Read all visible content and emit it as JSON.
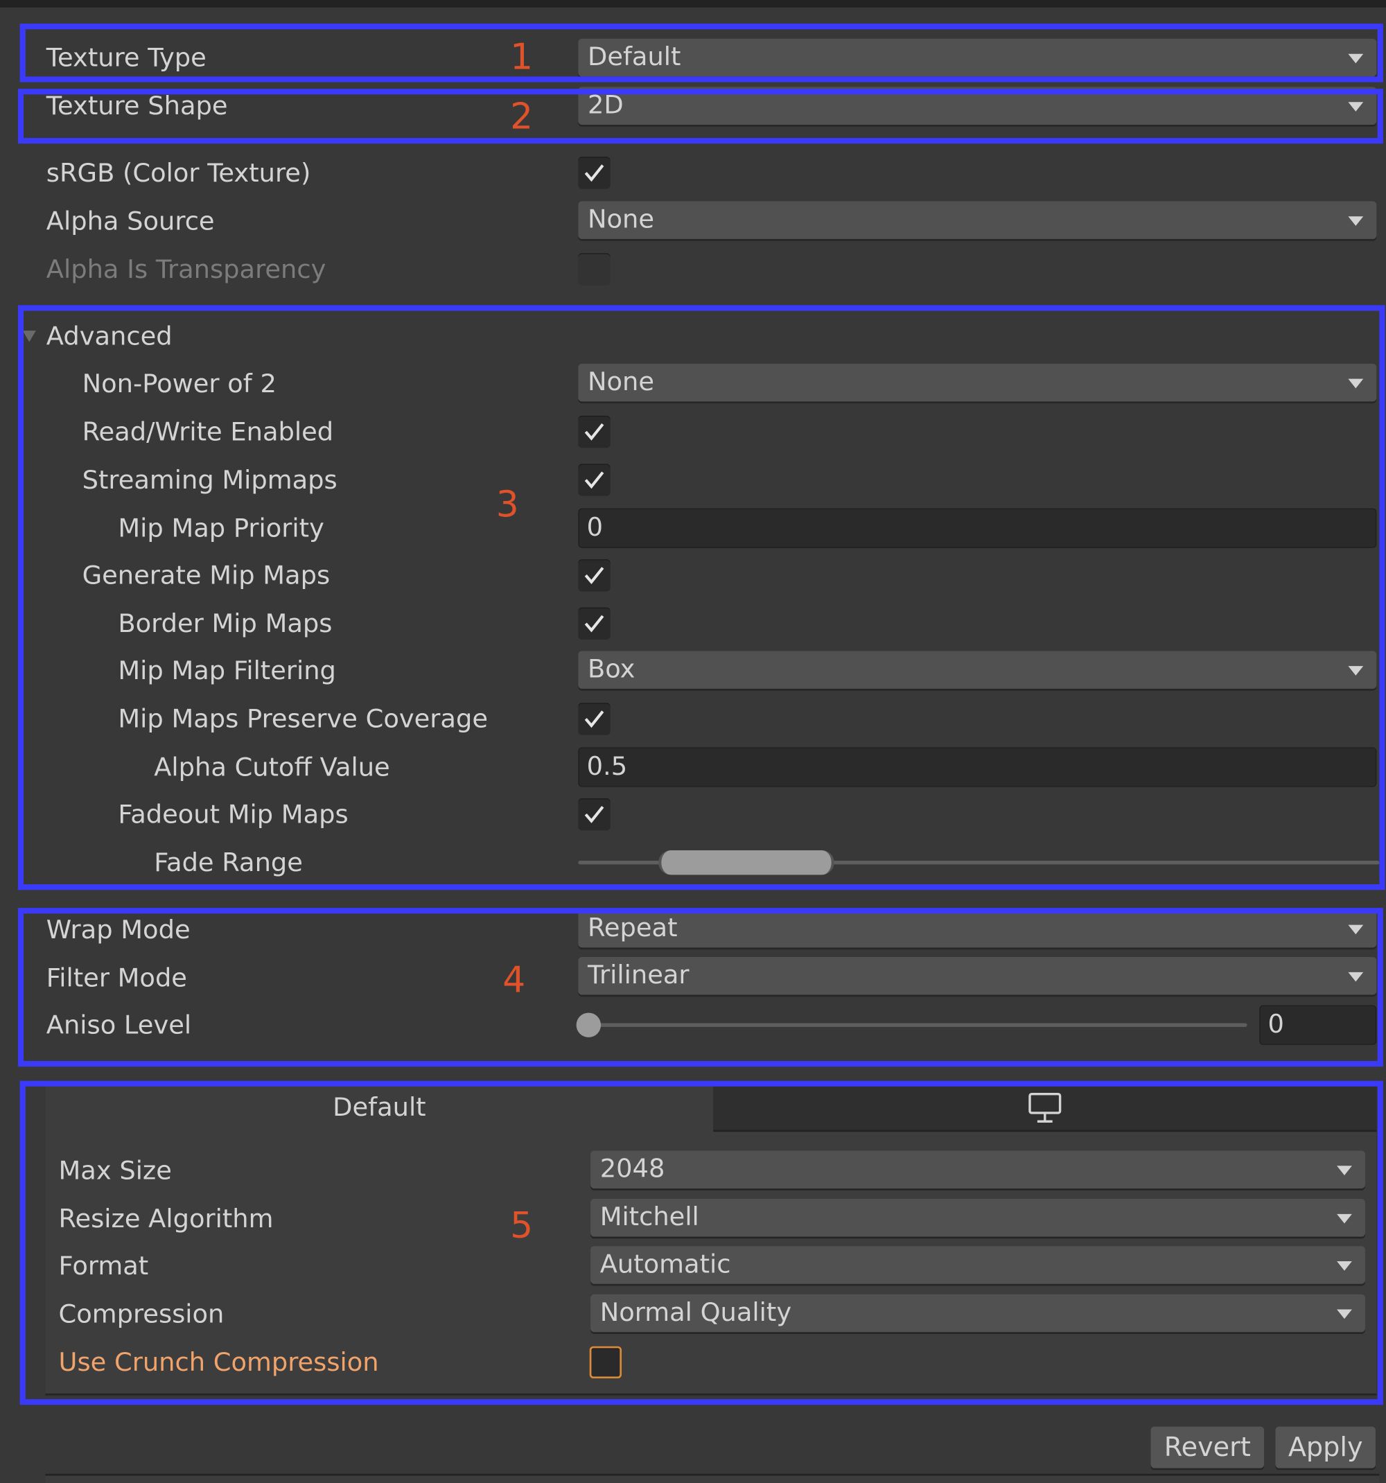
{
  "annotations": [
    "1",
    "2",
    "3",
    "4",
    "5"
  ],
  "colors": {
    "annotation_box": "#3a3af8",
    "annotation_number": "#e0522a",
    "warning_label": "#f0a36a",
    "background": "#383838"
  },
  "fields": {
    "texture_type": {
      "label": "Texture Type",
      "value": "Default"
    },
    "texture_shape": {
      "label": "Texture Shape",
      "value": "2D"
    },
    "srgb": {
      "label": "sRGB (Color Texture)",
      "checked": true
    },
    "alpha_source": {
      "label": "Alpha Source",
      "value": "None"
    },
    "alpha_is_transparency": {
      "label": "Alpha Is Transparency",
      "checked": false,
      "disabled": true
    }
  },
  "advanced": {
    "label": "Advanced",
    "expanded": true,
    "non_power_of_2": {
      "label": "Non-Power of 2",
      "value": "None"
    },
    "read_write": {
      "label": "Read/Write Enabled",
      "checked": true
    },
    "streaming_mipmaps": {
      "label": "Streaming Mipmaps",
      "checked": true
    },
    "mip_map_priority": {
      "label": "Mip Map Priority",
      "value": "0"
    },
    "generate_mip_maps": {
      "label": "Generate Mip Maps",
      "checked": true
    },
    "border_mip_maps": {
      "label": "Border Mip Maps",
      "checked": true
    },
    "mip_map_filtering": {
      "label": "Mip Map Filtering",
      "value": "Box"
    },
    "preserve_coverage": {
      "label": "Mip Maps Preserve Coverage",
      "checked": true
    },
    "alpha_cutoff": {
      "label": "Alpha Cutoff Value",
      "value": "0.5"
    },
    "fadeout_mip_maps": {
      "label": "Fadeout Mip Maps",
      "checked": true
    },
    "fade_range": {
      "label": "Fade Range",
      "min_fraction": 0.1,
      "max_fraction": 0.32
    }
  },
  "sampling": {
    "wrap_mode": {
      "label": "Wrap Mode",
      "value": "Repeat"
    },
    "filter_mode": {
      "label": "Filter Mode",
      "value": "Trilinear"
    },
    "aniso_level": {
      "label": "Aniso Level",
      "value": "0",
      "fraction": 0
    }
  },
  "platform": {
    "tabs": [
      {
        "label": "Default",
        "selected": true
      },
      {
        "icon": "monitor-icon",
        "selected": false
      }
    ],
    "max_size": {
      "label": "Max Size",
      "value": "2048"
    },
    "resize_algorithm": {
      "label": "Resize Algorithm",
      "value": "Mitchell"
    },
    "format": {
      "label": "Format",
      "value": "Automatic"
    },
    "compression": {
      "label": "Compression",
      "value": "Normal Quality"
    },
    "crunch": {
      "label": "Use Crunch Compression",
      "checked": false
    }
  },
  "buttons": {
    "revert": "Revert",
    "apply": "Apply"
  }
}
